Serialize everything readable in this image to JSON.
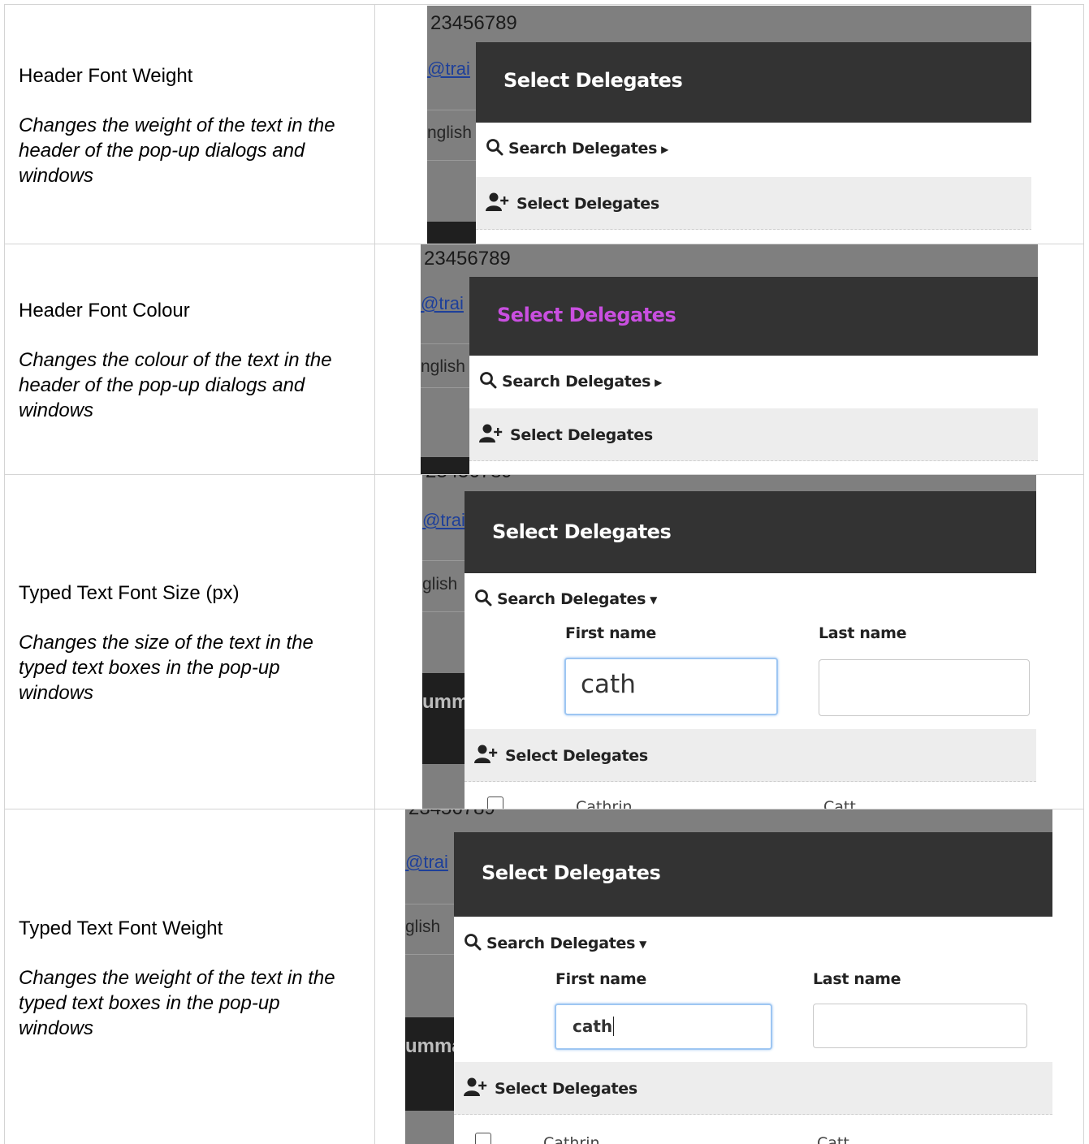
{
  "settings": [
    {
      "title": "Header Font Weight",
      "description": "Changes the weight of the text in the header of the pop-up dialogs and windows"
    },
    {
      "title": "Header Font Colour",
      "description": "Changes the colour of the text in the header of the pop-up dialogs and windows"
    },
    {
      "title": "Typed Text Font Size (px)",
      "description": "Changes the size of the text in the typed text boxes in the pop-up windows"
    },
    {
      "title": "Typed Text Font Weight",
      "description": "Changes the weight of the text in the typed text boxes in the pop-up windows"
    }
  ],
  "background_page": {
    "number": "23456789",
    "link": "@trai",
    "language": "nglish",
    "language_alt": "glish",
    "summary": "umma"
  },
  "dialog": {
    "header_title": "Select Delegates",
    "search_label": "Search Delegates",
    "select_label": "Select Delegates",
    "first_name_label": "First name",
    "last_name_label": "Last name",
    "first_name_value": "cath",
    "result_first": "Cathrin",
    "result_last": "Catt"
  },
  "colors": {
    "header_bg": "#333333",
    "header_text_default": "#ffffff",
    "header_text_coloured": "#c94fe0",
    "focus_border": "#9ec6f2",
    "backdrop": "#7f7f7f"
  },
  "icons": {
    "search": "search-icon",
    "add_user": "add-user-icon",
    "caret_right": "caret-right-icon",
    "caret_down": "caret-down-icon"
  }
}
